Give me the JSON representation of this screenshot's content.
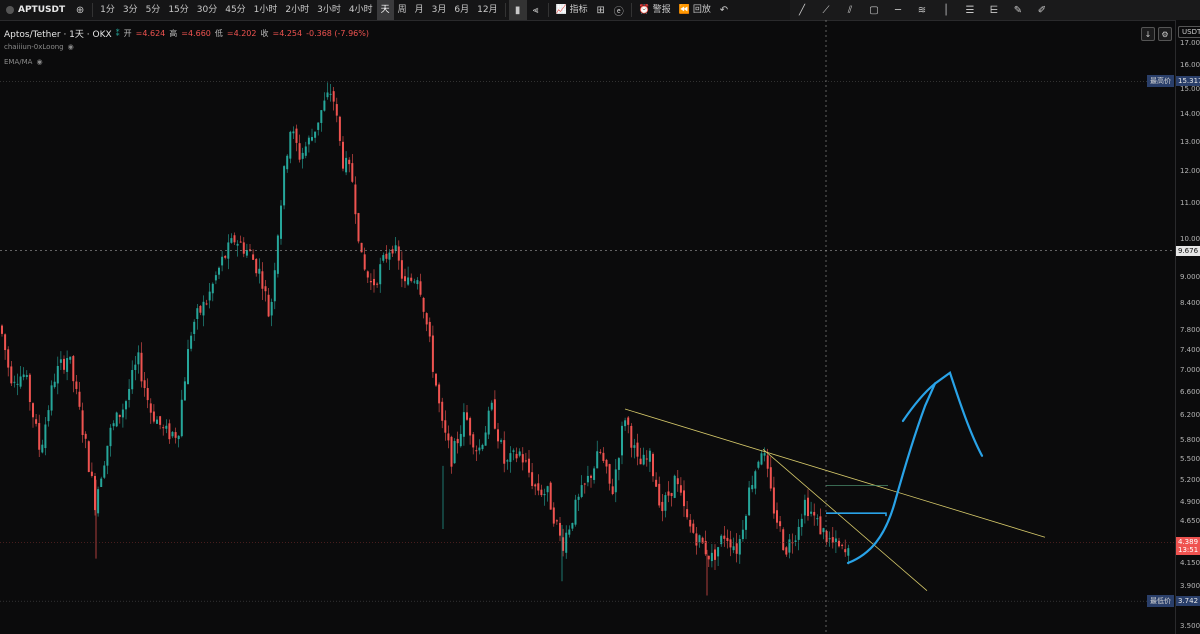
{
  "toolbar": {
    "symbol": "APTUSDT",
    "intervals": [
      "1分",
      "3分",
      "5分",
      "15分",
      "30分",
      "45分",
      "1小时",
      "2小时",
      "3小时",
      "4小时",
      "天",
      "周",
      "月",
      "3月",
      "6月",
      "12月"
    ],
    "active_interval": "天",
    "indicators_label": "指标",
    "alert_label": "警报",
    "replay_label": "回放"
  },
  "legend": {
    "name": "Aptos/Tether · 1天 · OKX",
    "open_label": "开",
    "open": "=4.624",
    "high_label": "高",
    "high": "=4.660",
    "low_label": "低",
    "low": "=4.202",
    "close_label": "收",
    "close": "=4.254",
    "change": "-0.368 (-7.96%)",
    "sub1": "chaiiiun-0xLoong",
    "sub2": "EMA/MA"
  },
  "axis": {
    "currency": "USDT",
    "ticks": [
      "17.000",
      "16.000",
      "15.000",
      "14.000",
      "13.000",
      "12.000",
      "11.000",
      "10.000",
      "9.000",
      "8.400",
      "7.800",
      "7.400",
      "7.000",
      "6.600",
      "6.200",
      "5.800",
      "5.500",
      "5.200",
      "4.900",
      "4.650",
      "4.150",
      "3.900",
      "3.500"
    ],
    "highest_label": "最高价",
    "highest_value": "15.317",
    "lowest_label": "最低价",
    "lowest_value": "3.742",
    "crosshair_value": "9.676",
    "last_price": "4.389",
    "countdown": "13:51"
  },
  "colors": {
    "up": "#26a69a",
    "down": "#ef5350",
    "trendline": "#d6c96a",
    "arrow": "#29a3e8",
    "axis_tag_blue": "#2a3f6a"
  },
  "chart_data": {
    "type": "candlestick",
    "ylim": [
      3.4,
      17.4
    ],
    "y_scale": "log",
    "current_price": 4.389,
    "crosshair_price": 9.676,
    "high_marker": 15.317,
    "low_marker": 3.742
  }
}
